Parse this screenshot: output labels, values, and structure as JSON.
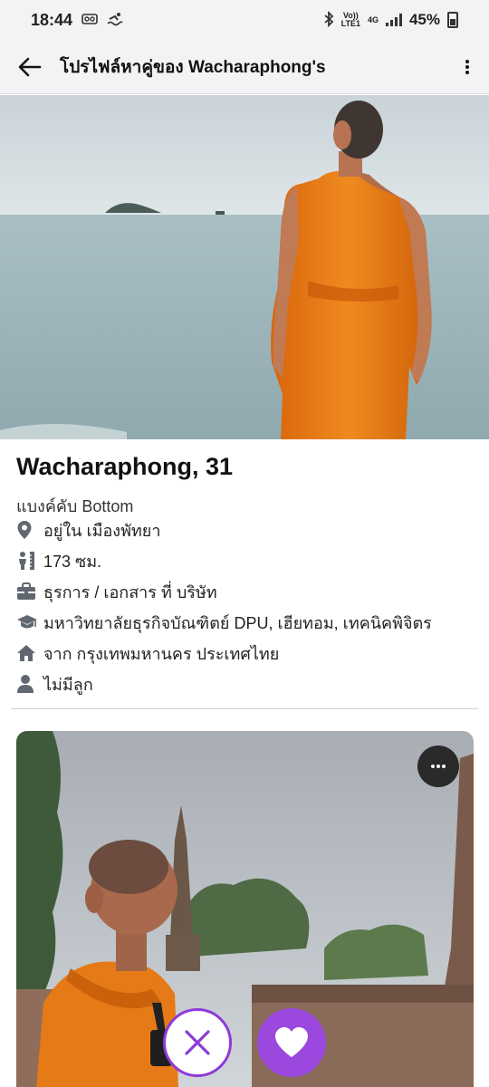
{
  "status_bar": {
    "time": "18:44",
    "network_top": "Vo))",
    "network_bottom": "LTE1",
    "network_gen": "4G",
    "battery": "45%"
  },
  "app_bar": {
    "title": "โปรไฟล์หาคู่ของ Wacharaphong's"
  },
  "profile": {
    "name_age": "Wacharaphong, 31",
    "tagline": "แบงค์คับ Bottom",
    "details": [
      {
        "icon": "location-pin-icon",
        "text": "อยู่ใน เมืองพัทยา"
      },
      {
        "icon": "height-icon",
        "text": "173 ซม."
      },
      {
        "icon": "briefcase-icon",
        "text": "ธุรการ / เอกสาร ที่ บริษัท"
      },
      {
        "icon": "graduation-cap-icon",
        "text": "มหาวิทยาลัยธุรกิจบัณฑิตย์ DPU, เฮียทอม, เทคนิคพิจิตร"
      },
      {
        "icon": "home-icon",
        "text": "จาก กรุงเทพมหานคร ประเทศไทย"
      },
      {
        "icon": "person-icon",
        "text": "ไม่มีลูก"
      }
    ]
  },
  "colors": {
    "accent": "#9b48df",
    "robe": "#e57a16",
    "sea": "#9fb7bd"
  }
}
